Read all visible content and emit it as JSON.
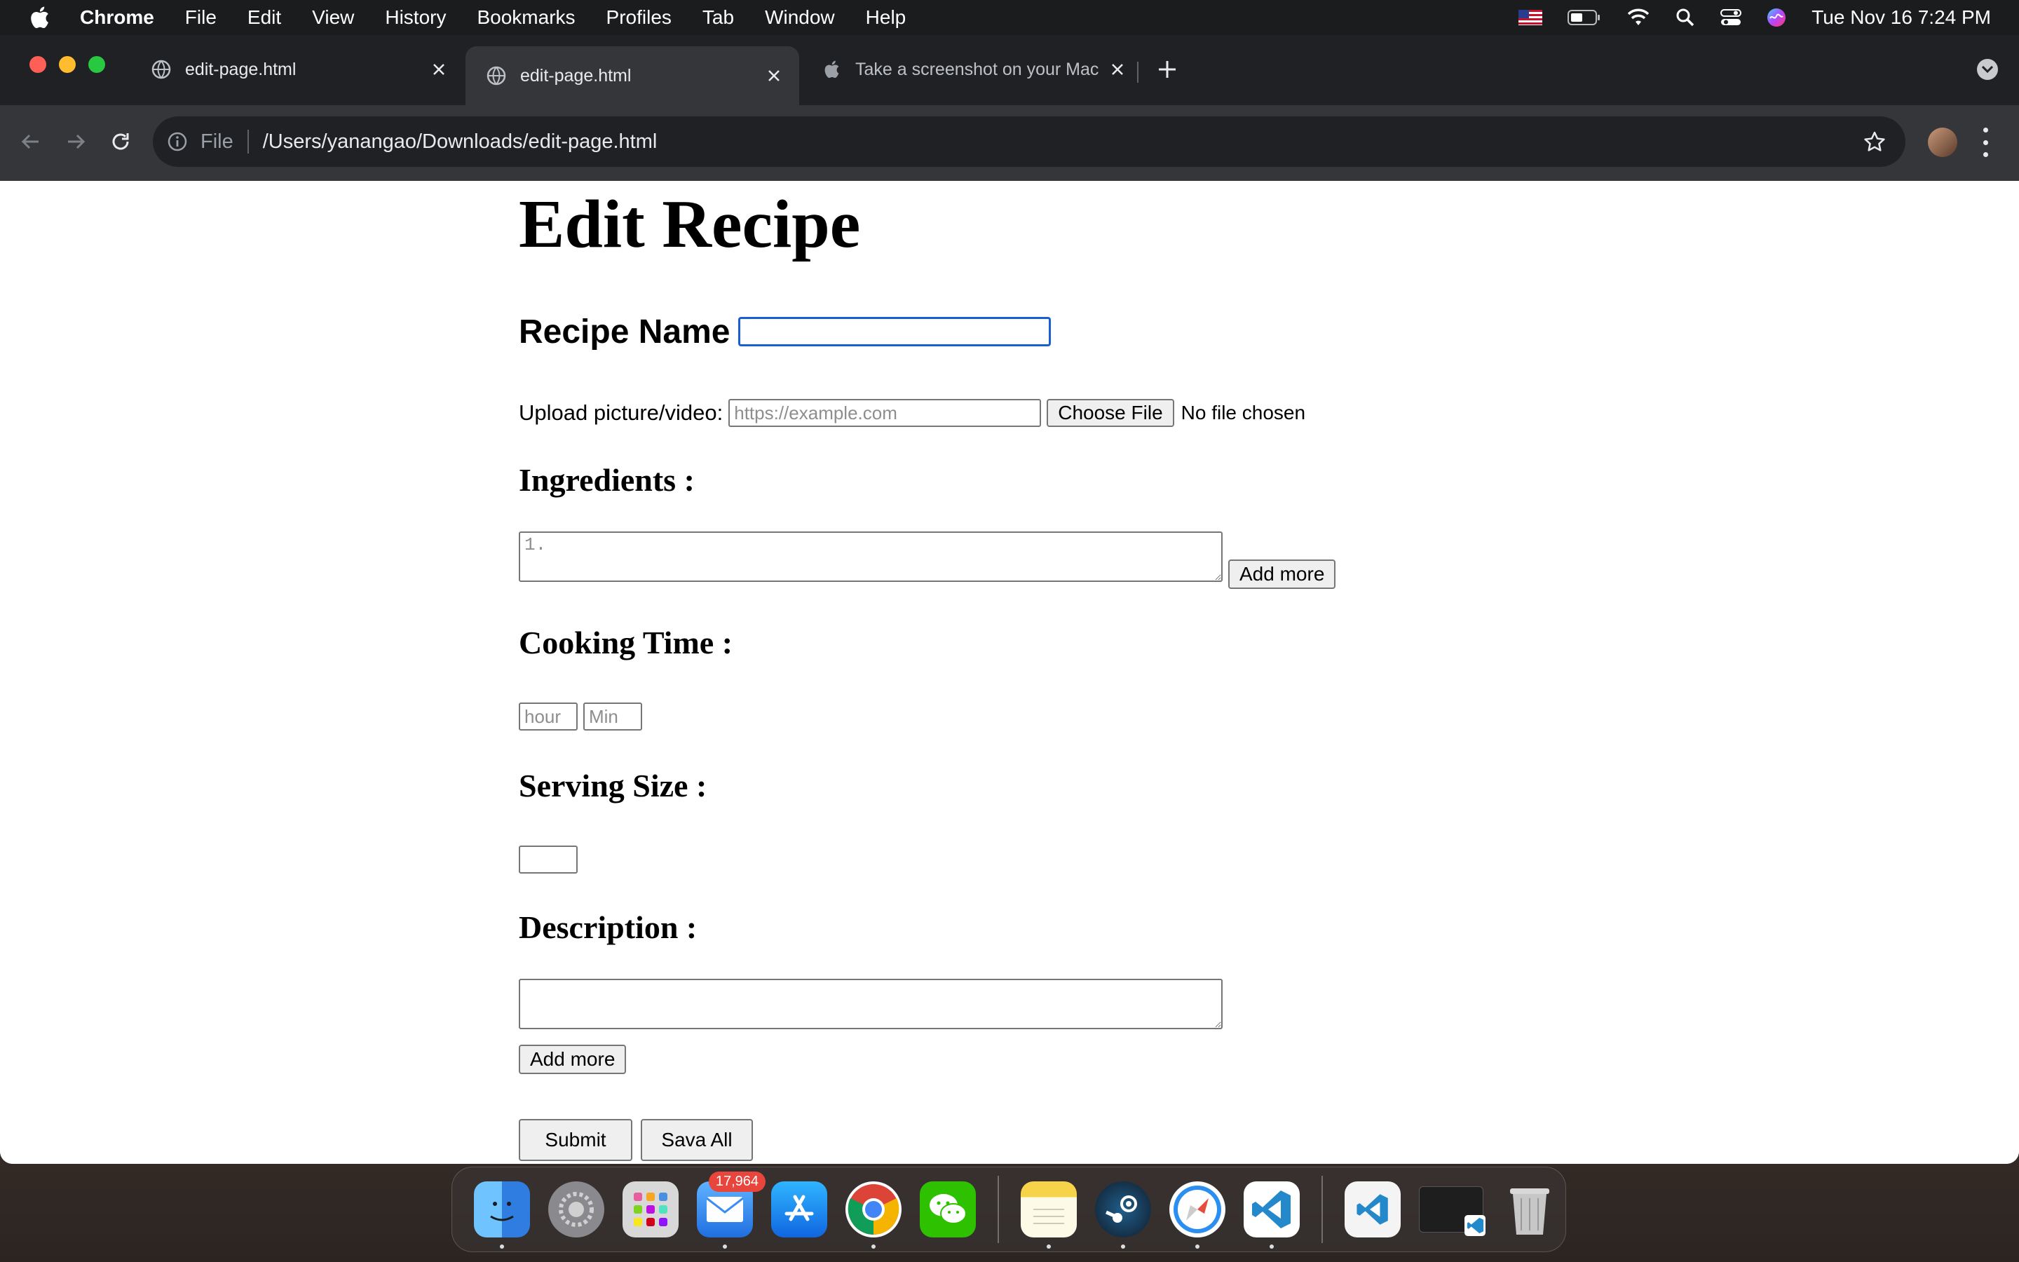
{
  "menubar": {
    "app": "Chrome",
    "items": [
      "File",
      "Edit",
      "View",
      "History",
      "Bookmarks",
      "Profiles",
      "Tab",
      "Window",
      "Help"
    ],
    "clock": "Tue Nov 16  7:24 PM"
  },
  "tabs": [
    {
      "title": "edit-page.html",
      "icon": "globe-icon",
      "active": false
    },
    {
      "title": "edit-page.html",
      "icon": "globe-icon",
      "active": true
    },
    {
      "title": "Take a screenshot on your Mac",
      "icon": "apple-icon",
      "active": false
    }
  ],
  "omnibox": {
    "scheme": "File",
    "url": "/Users/yanangao/Downloads/edit-page.html"
  },
  "page": {
    "title": "Edit Recipe",
    "recipe_name_label": "Recipe Name",
    "recipe_name_value": "",
    "upload_label": "Upload picture/video:",
    "upload_placeholder": "https://example.com",
    "choose_file_label": "Choose File",
    "no_file_text": "No file chosen",
    "ingredients_label": "Ingredients :",
    "ingredients_placeholder": "1.",
    "ingredients_add_more": "Add more",
    "cooking_time_label": "Cooking Time :",
    "hour_placeholder": "hour",
    "min_placeholder": "Min",
    "serving_size_label": "Serving Size :",
    "description_label": "Description :",
    "description_value": "",
    "description_add_more": "Add more",
    "submit_label": "Submit",
    "save_all_label": "Sava All"
  },
  "dock": {
    "apps": [
      {
        "name": "finder-icon",
        "color": "#3d8cf0"
      },
      {
        "name": "system-preferences-icon",
        "color": "#8a8a8e"
      },
      {
        "name": "launchpad-icon",
        "color": "#d8d8d8"
      },
      {
        "name": "mail-icon",
        "color": "#3b8df5",
        "badge": "17,964"
      },
      {
        "name": "app-store-icon",
        "color": "#1a8cf5"
      },
      {
        "name": "chrome-icon",
        "color": "#ffffff"
      },
      {
        "name": "wechat-icon",
        "color": "#2dc100"
      },
      {
        "name": "notes-icon",
        "color": "#f5d547"
      },
      {
        "name": "steam-icon",
        "color": "#1b2838"
      },
      {
        "name": "safari-icon",
        "color": "#2a8ff0"
      },
      {
        "name": "vscode-icon",
        "color": "#ffffff"
      },
      {
        "name": "vscode-document-icon",
        "color": "#ffffff"
      },
      {
        "name": "screen-window-icon",
        "color": "#1e1e1e"
      },
      {
        "name": "trash-icon",
        "color": "#c7c7c7"
      }
    ]
  },
  "colors": {
    "focus_ring": "#1a5fd1",
    "tab_strip": "#202124",
    "toolbar": "#35363a"
  }
}
